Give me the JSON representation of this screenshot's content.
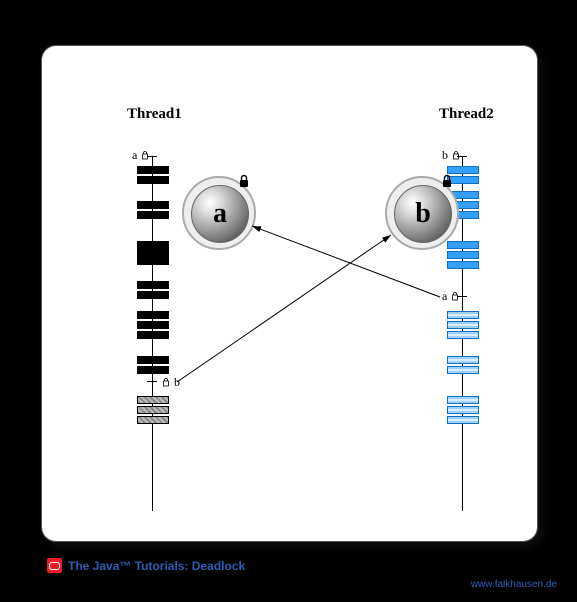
{
  "threads": {
    "left": "Thread1",
    "right": "Thread2"
  },
  "spheres": {
    "left": "a",
    "right": "b"
  },
  "spheres_icon": "lock-icon",
  "axis_labels": {
    "left_top": "a",
    "left_mid": "b",
    "right_top": "b",
    "right_mid": "a"
  },
  "source": {
    "brand_icon": "oracle-icon",
    "text": "The Java™ Tutorials: Deadlock"
  },
  "attribution": "www.falkhausen.de",
  "diagram": {
    "description": "Deadlock: Thread1 holds lock a then waits for b; Thread2 holds lock b then waits for a.",
    "left_bars": {
      "solid": [
        120,
        130,
        155,
        165,
        195,
        203,
        211,
        235,
        245,
        265,
        275,
        285,
        310,
        320
      ],
      "hatched": [
        350,
        360,
        370
      ]
    },
    "right_bars": {
      "solid": [
        120,
        130,
        145,
        155,
        165,
        195,
        205,
        215
      ],
      "hatched": [
        265,
        275,
        285,
        310,
        320,
        350,
        360,
        370
      ]
    },
    "arrows": [
      {
        "from": "thread1_wait_b",
        "to": "sphere_b"
      },
      {
        "from": "thread2_wait_a",
        "to": "sphere_a"
      }
    ]
  }
}
